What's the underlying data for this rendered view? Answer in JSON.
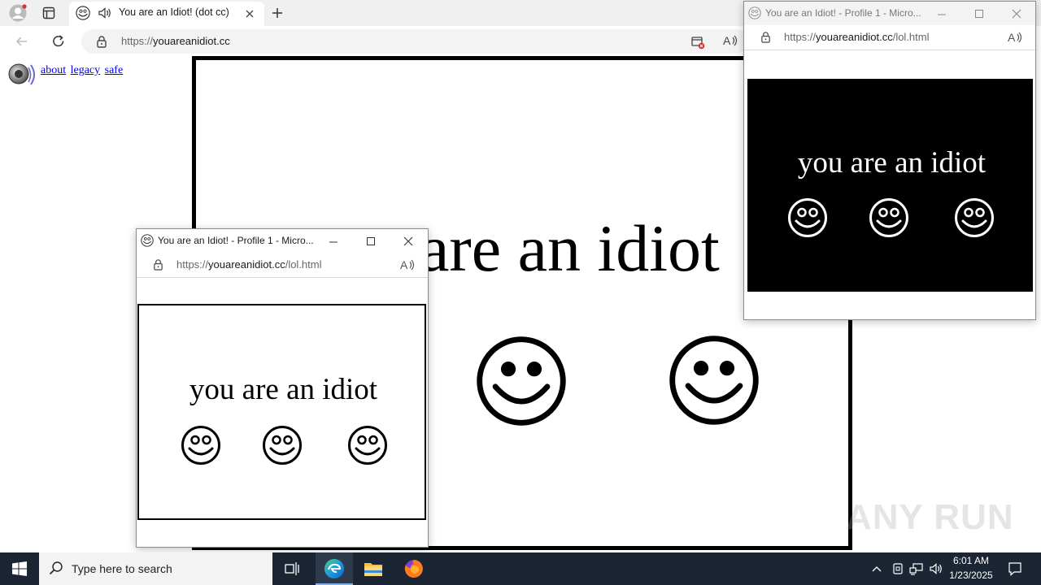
{
  "browser": {
    "tab": {
      "title": "You are an Idiot! (dot cc)"
    },
    "address": {
      "scheme": "https://",
      "host": "youareanidiot.cc"
    },
    "page": {
      "links": [
        "about",
        "legacy",
        "safe"
      ],
      "main_text": "are an idiot",
      "smiley_icon": "smiley-face"
    }
  },
  "popups": [
    {
      "title": "You are an Idiot! - Profile 1 - Micro...",
      "url_scheme": "https://",
      "url_host": "youareanidiot.cc",
      "url_path": "/lol.html",
      "text": "you are an idiot",
      "theme": "white"
    },
    {
      "title": "You are an Idiot! - Profile 1 - Micro...",
      "url_scheme": "https://",
      "url_host": "youareanidiot.cc",
      "url_path": "/lol.html",
      "text": "you are an idiot",
      "theme": "black"
    }
  ],
  "taskbar": {
    "search_placeholder": "Type here to search",
    "time": "6:01 AM",
    "date": "1/23/2025",
    "pinned": [
      "task-view",
      "edge",
      "file-explorer",
      "firefox"
    ]
  },
  "watermark": "ANY RUN"
}
